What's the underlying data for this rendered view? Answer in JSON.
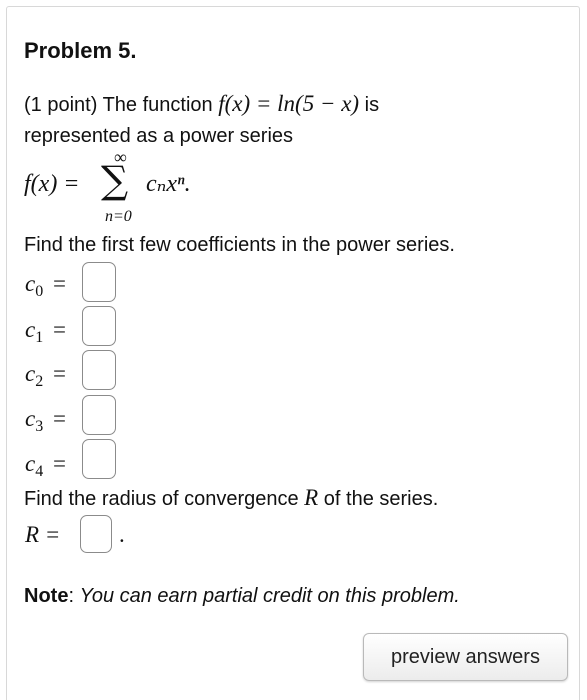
{
  "problem": {
    "title": "Problem 5.",
    "points": "(1 point)",
    "intro_text": "The function",
    "function_expr": "f(x) = ln(5 − x)",
    "intro_is": "is",
    "intro_line2": "represented as a power series",
    "series_lhs": "f(x) =",
    "sum_symbol": "∑",
    "sum_upper": "∞",
    "sum_lower": "n=0",
    "series_term": "cₙxⁿ.",
    "coef_prompt": "Find the first few coefficients in the power series.",
    "coefficients": [
      {
        "symbol": "c",
        "index": "0",
        "value": ""
      },
      {
        "symbol": "c",
        "index": "1",
        "value": ""
      },
      {
        "symbol": "c",
        "index": "2",
        "value": ""
      },
      {
        "symbol": "c",
        "index": "3",
        "value": ""
      },
      {
        "symbol": "c",
        "index": "4",
        "value": ""
      }
    ],
    "equals": "=",
    "radius_prompt_before": "Find the radius of convergence",
    "radius_symbol": "R",
    "radius_prompt_after": "of the series.",
    "radius_label": "R =",
    "radius_value": "",
    "radius_period": ".",
    "note_label": "Note",
    "note_colon": ":",
    "note_text": "You can earn partial credit on this problem."
  },
  "buttons": {
    "preview": "preview answers"
  }
}
